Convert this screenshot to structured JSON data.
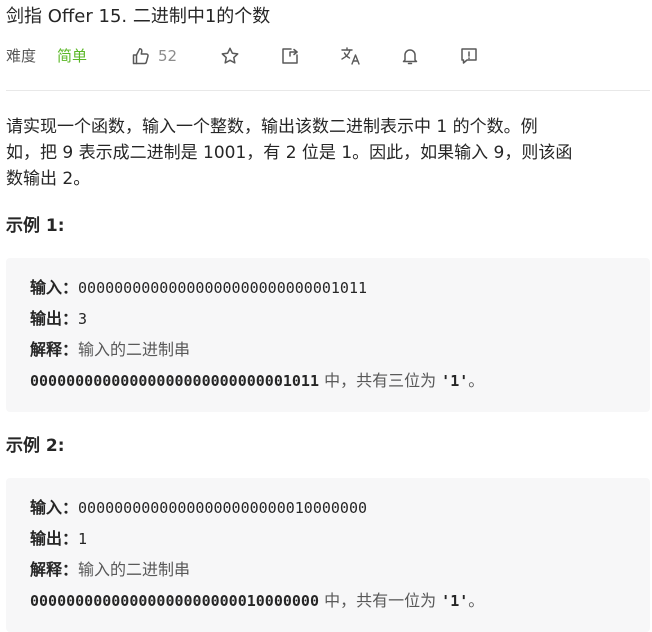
{
  "problem": {
    "title": "剑指 Offer 15. 二进制中1的个数",
    "difficulty_label": "难度",
    "difficulty": "简单",
    "like_count": "52"
  },
  "toolbar": {
    "like_icon": "thumbs-up-icon",
    "star_icon": "star-icon",
    "share_icon": "share-icon",
    "translate_icon": "translate-icon",
    "bell_icon": "bell-icon",
    "feedback_icon": "feedback-icon"
  },
  "description": {
    "line1": "请实现一个函数，输入一个整数，输出该数二进制表示中 1 的个数。例",
    "line2": "如，把 9 表示成二进制是 1001，有 2 位是 1。因此，如果输入 9，则该函",
    "line3": "数输出 2。"
  },
  "examples": [
    {
      "heading": "示例 1:",
      "input_label": "输入：",
      "input_value": "00000000000000000000000000001011",
      "output_label": "输出：",
      "output_value": "3",
      "explain_label": "解释：",
      "explain_text": "输入的二进制串",
      "detail_code": "00000000000000000000000000001011",
      "detail_mid": " 中，共有三位为 ",
      "detail_quote": "'1'",
      "detail_end": "。"
    },
    {
      "heading": "示例 2:",
      "input_label": "输入：",
      "input_value": "00000000000000000000000010000000",
      "output_label": "输出：",
      "output_value": "1",
      "explain_label": "解释：",
      "explain_text": "输入的二进制串",
      "detail_code": "00000000000000000000000010000000",
      "detail_mid": " 中，共有一位为 ",
      "detail_quote": "'1'",
      "detail_end": "。"
    }
  ],
  "colors": {
    "difficulty_easy": "#5ab726",
    "example_bg": "#f7f7f8",
    "text": "#262626",
    "muted": "#595959"
  }
}
